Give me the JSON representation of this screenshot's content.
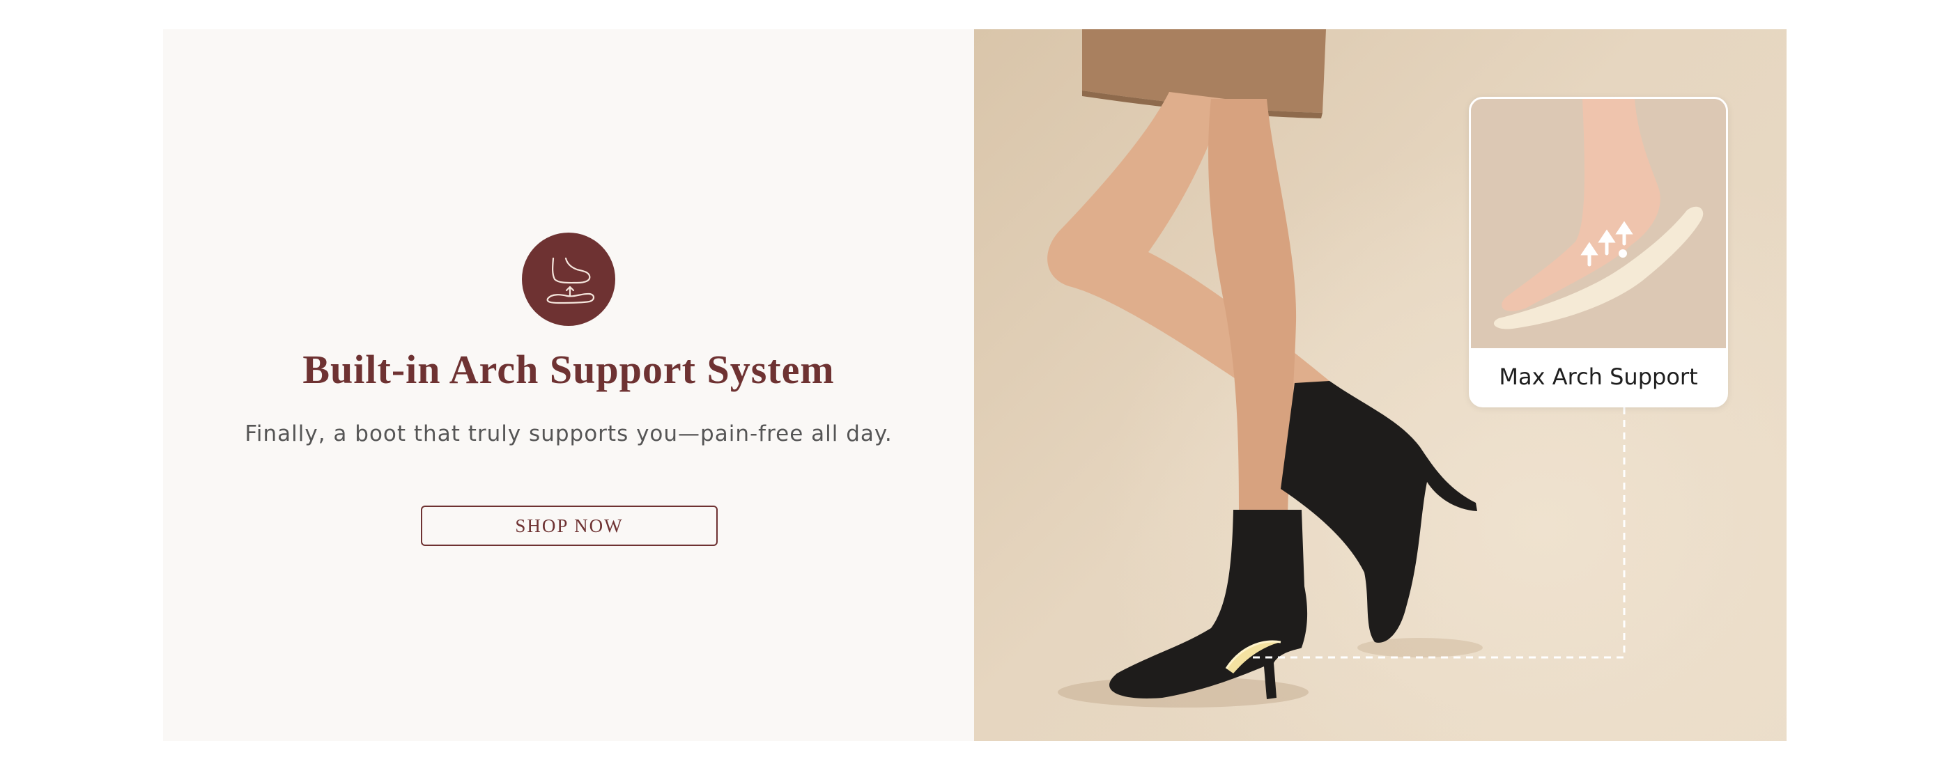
{
  "banner": {
    "icon": "foot-arch-support-icon",
    "headline": "Built-in Arch Support System",
    "subheadline": "Finally, a boot that truly supports you—pain-free all day.",
    "cta_label": "SHOP NOW",
    "inset_caption": "Max Arch Support"
  },
  "colors": {
    "brand": "#6e3232",
    "panel_bg": "#faf8f6",
    "photo_bg": "#e6d6c0"
  }
}
